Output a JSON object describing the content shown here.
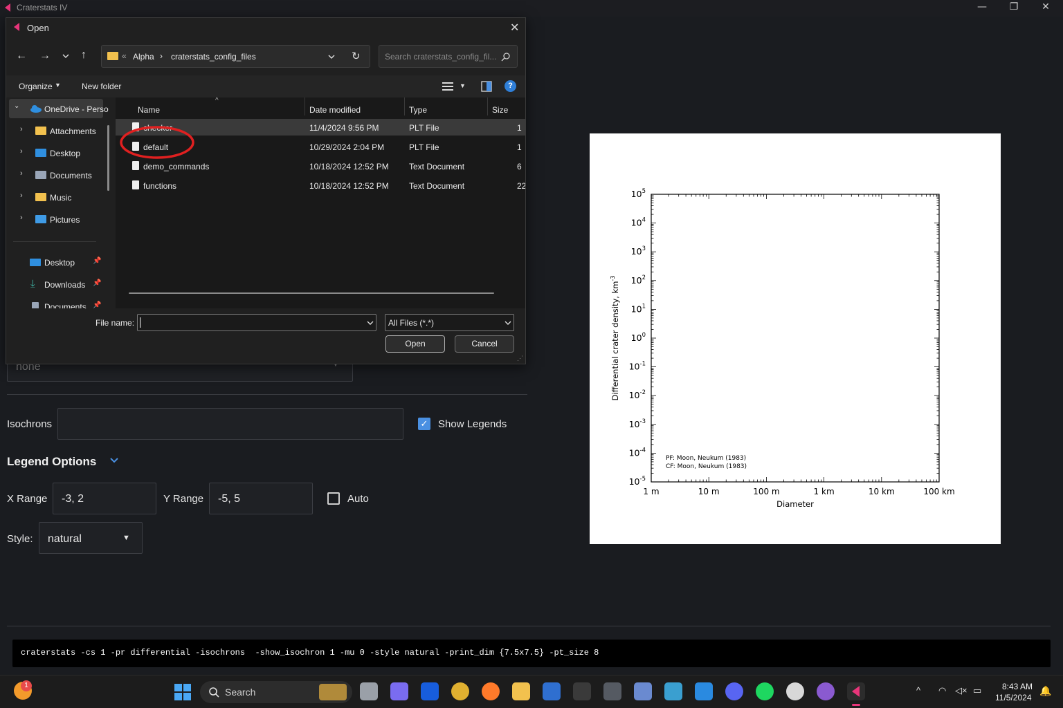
{
  "app": {
    "title": "Craterstats IV",
    "window_controls": {
      "minimize": "—",
      "maximize": "❐",
      "close": "✕"
    }
  },
  "form": {
    "hidden_dropdown_value": "none",
    "isochrons_label": "Isochrons",
    "isochrons_value": "",
    "show_legends_label": "Show Legends",
    "show_legends_checked": true,
    "legend_options_label": "Legend Options",
    "x_range_label": "X Range",
    "x_range_value": "-3, 2",
    "y_range_label": "Y Range",
    "y_range_value": "-5, 5",
    "auto_label": "Auto",
    "auto_checked": false,
    "style_label": "Style:",
    "style_value": "natural"
  },
  "command": {
    "text": "craterstats -cs 1 -pr differential -isochrons  -show_isochron 1 -mu 0 -style natural -print_dim {7.5x7.5} -pt_size 8"
  },
  "chart_data": {
    "type": "scatter",
    "title": "",
    "xlabel": "Diameter",
    "ylabel": "Differential crater density, km",
    "ylabel_sup": "-3",
    "x_scale": "log",
    "y_scale": "log",
    "x_tick_labels": [
      "1 m",
      "10 m",
      "100 m",
      "1 km",
      "10 km",
      "100 km"
    ],
    "y_tick_base": "10",
    "y_tick_exponents": [
      "5",
      "4",
      "3",
      "2",
      "1",
      "0",
      "-1",
      "-2",
      "-3",
      "-4",
      "-5"
    ],
    "xlim_km": [
      0.001,
      100
    ],
    "ylim": [
      1e-05,
      100000.0
    ],
    "series": [],
    "annotations": [
      "PF: Moon, Neukum (1983)",
      "CF: Moon, Neukum (1983)"
    ]
  },
  "dialog": {
    "title": "Open",
    "close": "✕",
    "breadcrumb": {
      "prefix": "«",
      "parent": "Alpha",
      "sep": "›",
      "current": "craterstats_config_files"
    },
    "search_placeholder": "Search craterstats_config_fil...",
    "toolbar": {
      "organize": "Organize",
      "new_folder": "New folder",
      "help": "?"
    },
    "nav": {
      "onedrive": "OneDrive - Perso",
      "folders": [
        "Attachments",
        "Desktop",
        "Documents",
        "Music",
        "Pictures"
      ],
      "quick": [
        "Desktop",
        "Downloads",
        "Documents"
      ]
    },
    "columns": {
      "name": "Name",
      "date": "Date modified",
      "type": "Type",
      "size": "Size"
    },
    "files": [
      {
        "name": "checker",
        "date": "11/4/2024 9:56 PM",
        "type": "PLT File",
        "size": "1"
      },
      {
        "name": "default",
        "date": "10/29/2024 2:04 PM",
        "type": "PLT File",
        "size": "1"
      },
      {
        "name": "demo_commands",
        "date": "10/18/2024 12:52 PM",
        "type": "Text Document",
        "size": "6"
      },
      {
        "name": "functions",
        "date": "10/18/2024 12:52 PM",
        "type": "Text Document",
        "size": "22"
      }
    ],
    "file_name_label": "File name:",
    "file_name_value": "",
    "filter_value": "All Files (*.*)",
    "open_label": "Open",
    "cancel_label": "Cancel"
  },
  "taskbar": {
    "search_label": "Search",
    "notification_badge": "1",
    "time": "8:43 AM",
    "date": "11/5/2024"
  }
}
